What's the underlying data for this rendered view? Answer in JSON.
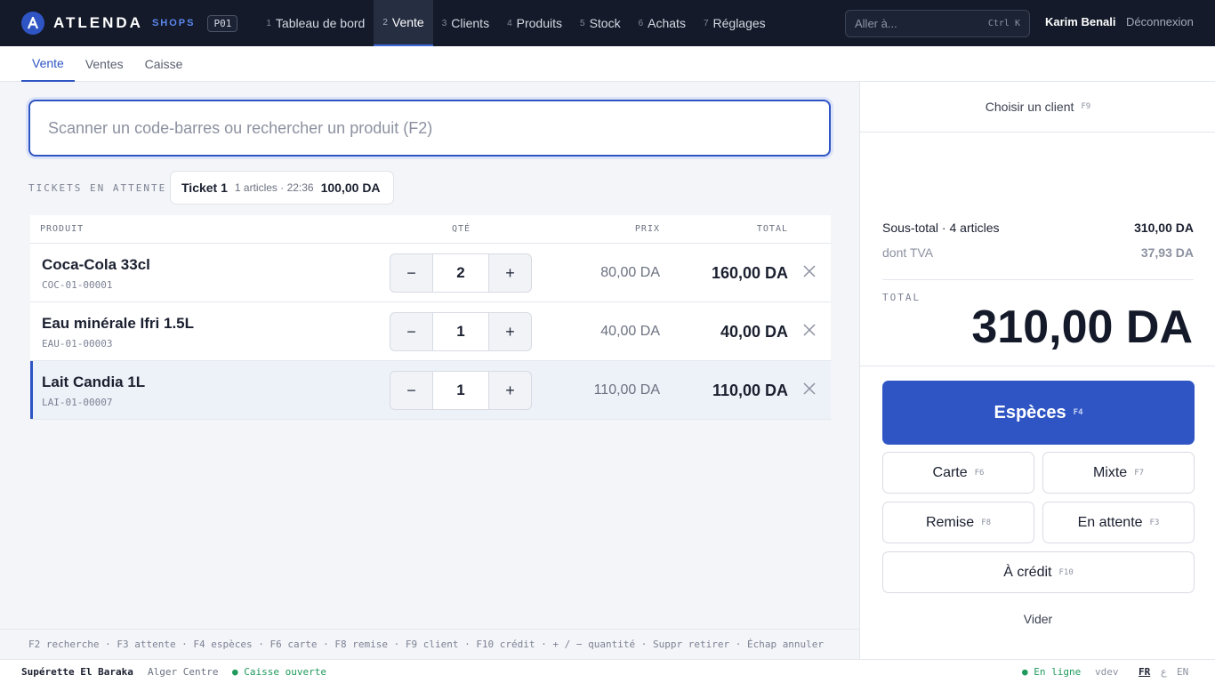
{
  "app": {
    "brand": "ATLENDA",
    "brand_sub": "SHOPS",
    "pos_code": "P01"
  },
  "nav": {
    "items": [
      {
        "num": "1",
        "label": "Tableau de bord"
      },
      {
        "num": "2",
        "label": "Vente"
      },
      {
        "num": "3",
        "label": "Clients"
      },
      {
        "num": "4",
        "label": "Produits"
      },
      {
        "num": "5",
        "label": "Stock"
      },
      {
        "num": "6",
        "label": "Achats"
      },
      {
        "num": "7",
        "label": "Réglages"
      }
    ],
    "goto_placeholder": "Aller à...",
    "goto_shortcut": "Ctrl K",
    "user": "Karim Benali",
    "logout": "Déconnexion"
  },
  "subtabs": [
    "Vente",
    "Ventes",
    "Caisse"
  ],
  "search": {
    "placeholder": "Scanner un code-barres ou rechercher un produit (F2)"
  },
  "held": {
    "label": "TICKETS EN ATTENTE",
    "ticket": {
      "name": "Ticket 1",
      "meta": "1 articles · 22:36",
      "amount": "100,00 DA"
    }
  },
  "cart": {
    "headers": {
      "product": "PRODUIT",
      "qty": "QTÉ",
      "price": "PRIX",
      "total": "TOTAL"
    },
    "rows": [
      {
        "name": "Coca-Cola 33cl",
        "sku": "COC-01-00001",
        "qty": "2",
        "price": "80,00 DA",
        "total": "160,00 DA"
      },
      {
        "name": "Eau minérale Ifri 1.5L",
        "sku": "EAU-01-00003",
        "qty": "1",
        "price": "40,00 DA",
        "total": "40,00 DA"
      },
      {
        "name": "Lait Candia 1L",
        "sku": "LAI-01-00007",
        "qty": "1",
        "price": "110,00 DA",
        "total": "110,00 DA"
      }
    ],
    "minus": "−",
    "plus": "+"
  },
  "shortcuts": "F2 recherche · F3 attente · F4 espèces · F6 carte · F8 remise · F9 client · F10 crédit · + / − quantité · Suppr retirer · Échap annuler",
  "summary": {
    "choose_client": "Choisir un client",
    "choose_client_key": "F9",
    "subtotal_label": "Sous-total · 4 articles",
    "subtotal_value": "310,00 DA",
    "tva_label": "dont TVA",
    "tva_value": "37,93 DA",
    "total_label": "TOTAL",
    "total_value": "310,00 DA"
  },
  "payment": {
    "cash": {
      "label": "Espèces",
      "key": "F4"
    },
    "card": {
      "label": "Carte",
      "key": "F6"
    },
    "mixed": {
      "label": "Mixte",
      "key": "F7"
    },
    "discount": {
      "label": "Remise",
      "key": "F8"
    },
    "hold": {
      "label": "En attente",
      "key": "F3"
    },
    "credit": {
      "label": "À crédit",
      "key": "F10"
    },
    "clear": "Vider"
  },
  "status": {
    "store": "Supérette El Baraka",
    "location": "Alger Centre",
    "register": "● Caisse ouverte",
    "online": "● En ligne",
    "version": "vdev",
    "lang_fr": "FR",
    "lang_ar": "ع",
    "lang_en": "EN"
  },
  "colors": {
    "topbar": "#141a29",
    "accent": "#2f55c4",
    "success": "#1d9a5c"
  }
}
